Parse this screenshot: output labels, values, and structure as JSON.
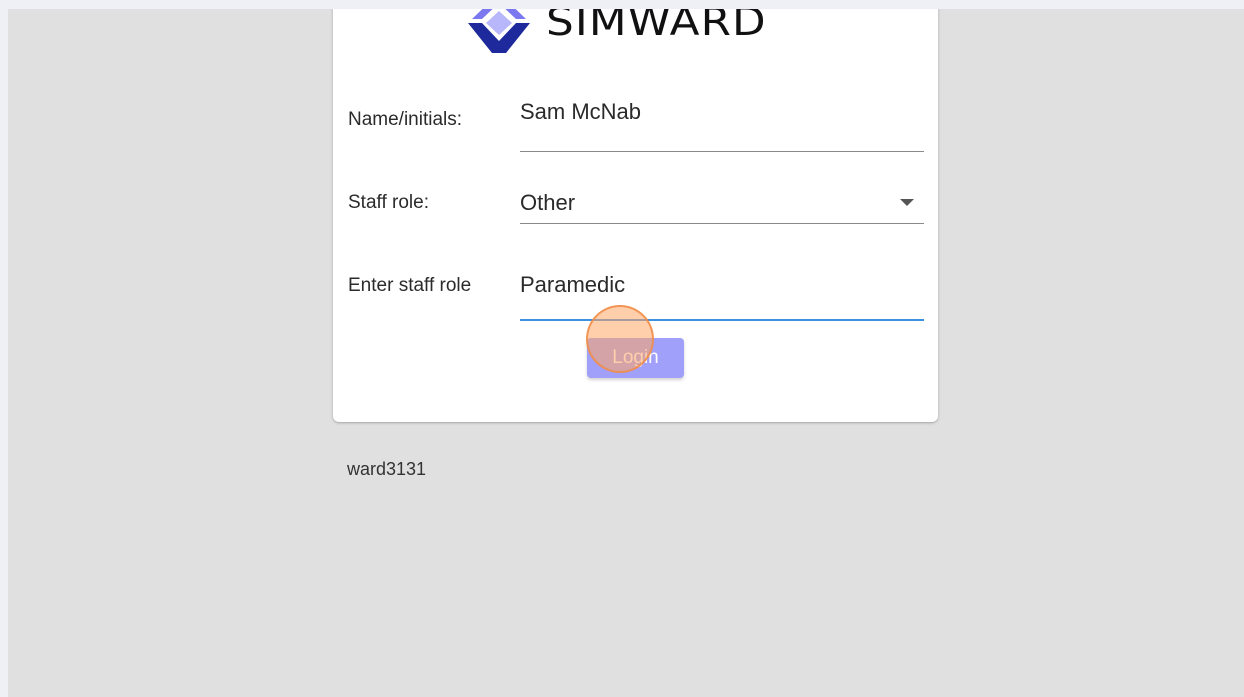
{
  "brand": {
    "name": "SIMWARD",
    "logo_icon": "simward-logo-icon",
    "logo_colors": [
      "#7b78f0",
      "#1e2a9b"
    ]
  },
  "form": {
    "name": {
      "label": "Name/initials:",
      "value": "Sam McNab"
    },
    "staff_role": {
      "label": "Staff role:",
      "value": "Other",
      "icon": "chevron-down-icon"
    },
    "custom_role": {
      "label": "Enter staff role",
      "value": "Paramedic"
    },
    "login_label": "Login"
  },
  "footer": {
    "ward_id": "ward3131"
  },
  "colors": {
    "accent": "#3d8fe0",
    "button": "#a09ffa",
    "page_background": "#e0e0e0",
    "card_background": "#ffffff",
    "click_indicator": "#f0a060"
  }
}
